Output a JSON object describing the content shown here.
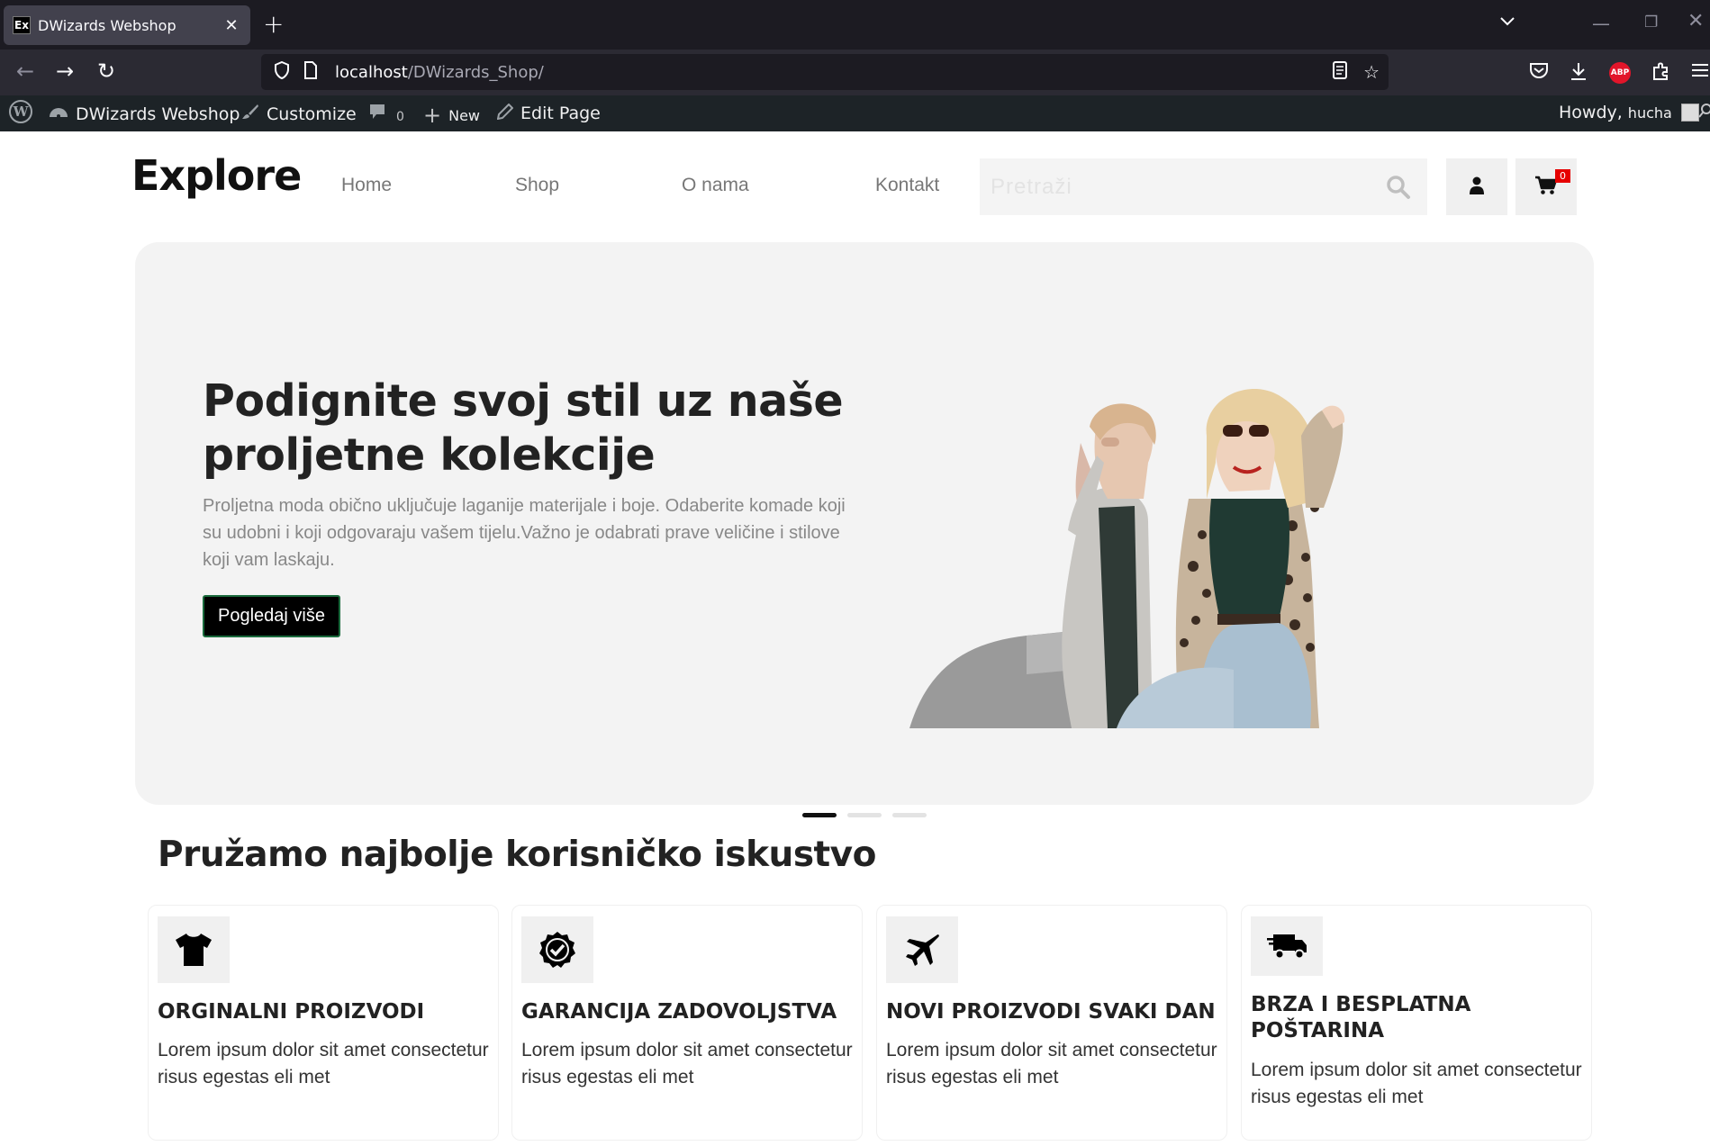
{
  "browser": {
    "tab_title": "DWizards Webshop",
    "tab_favicon": "Ex",
    "url_host": "localhost",
    "url_path": "/DWizards_Shop/"
  },
  "adminbar": {
    "site_name": "DWizards Webshop",
    "customize": "Customize",
    "comments_count": "0",
    "new_label": "New",
    "edit_page": "Edit Page",
    "howdy": "Howdy,",
    "username": "hucha"
  },
  "header": {
    "logo": "Explore",
    "menu": [
      "Home",
      "Shop",
      "O nama",
      "Kontakt"
    ],
    "search_placeholder": "Pretraži",
    "cart_count": "0"
  },
  "hero": {
    "title": "Podignite svoj stil uz naše proljetne kolekcije",
    "text": "Proljetna moda obično uključuje laganije materijale i boje. Odaberite komade koji su udobni i koji odgovaraju vašem tijelu.Važno je odabrati prave veličine i stilove koji vam laskaju.",
    "button": "Pogledaj više",
    "slides_total": 3,
    "active_slide": 1
  },
  "features": {
    "title": "Pružamo najbolje korisničko iskustvo",
    "items": [
      {
        "icon": "tshirt-icon",
        "name": "ORGINALNI PROIZVODI",
        "desc": "Lorem ipsum dolor sit amet consectetur risus egestas eli met"
      },
      {
        "icon": "badge-check-icon",
        "name": "GARANCIJA ZADOVOLJSTVA",
        "desc": "Lorem ipsum dolor sit amet consectetur risus egestas eli met"
      },
      {
        "icon": "plane-icon",
        "name": "NOVI PROIZVODI SVAKI DAN",
        "desc": "Lorem ipsum dolor sit amet consectetur risus egestas eli met"
      },
      {
        "icon": "truck-icon",
        "name": "BRZA I BESPLATNA POŠTARINA",
        "desc": "Lorem ipsum dolor sit amet consectetur risus egestas eli met"
      }
    ]
  },
  "colors": {
    "hero_bg": "#f3f3f3",
    "button_bg": "#000000",
    "badge_red": "#e60000",
    "admin_bar": "#1d2327"
  }
}
